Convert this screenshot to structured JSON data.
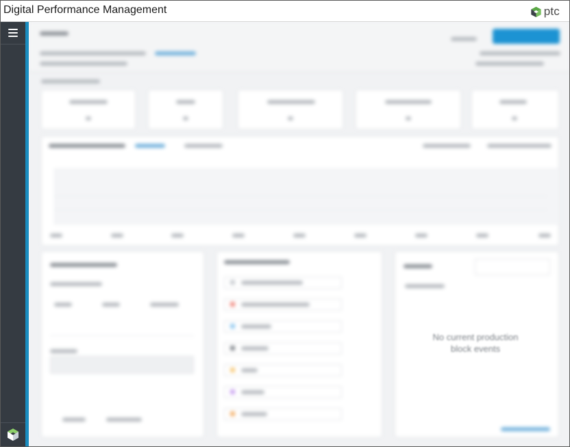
{
  "app": {
    "title": "Digital Performance Management"
  },
  "brand": {
    "name": "ptc",
    "logo_icon": "ptc-logo-icon"
  },
  "sidebar": {
    "menu_icon": "hamburger-menu-icon",
    "bottom_icon": "app-cube-icon"
  },
  "colors": {
    "accent": "#1a8cbf",
    "sidebar": "#353b42",
    "primary_button": "#1c93d3",
    "brand_green": "#5aa846"
  },
  "empty_state": {
    "line1": "No current production",
    "line2": "block events"
  }
}
